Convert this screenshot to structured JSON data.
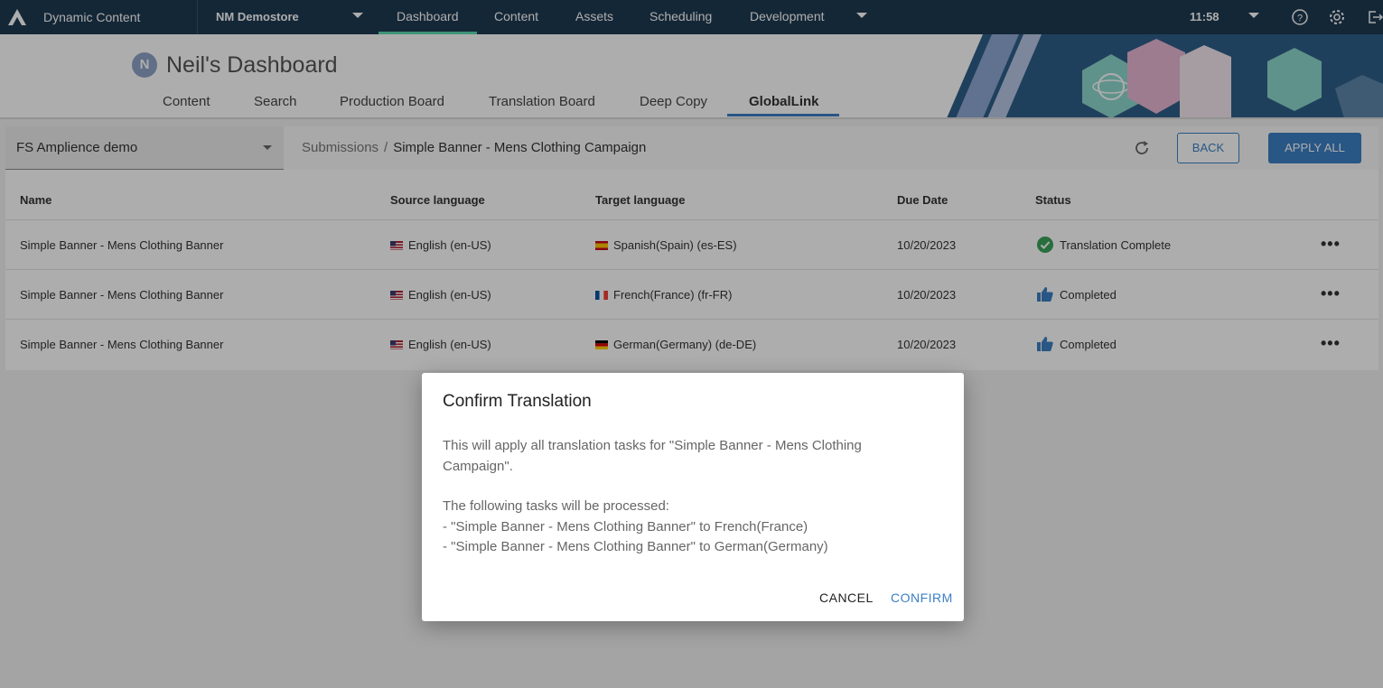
{
  "topbar": {
    "app_title": "Dynamic Content",
    "store": "NM Demostore",
    "nav": [
      "Dashboard",
      "Content",
      "Assets",
      "Scheduling",
      "Development"
    ],
    "active_nav": "Dashboard",
    "time": "11:58"
  },
  "header": {
    "avatar_initial": "N",
    "title": "Neil's Dashboard",
    "tabs": [
      "Content",
      "Search",
      "Production Board",
      "Translation Board",
      "Deep Copy",
      "GlobalLink"
    ],
    "active_tab": "GlobalLink"
  },
  "toolbar": {
    "project": "FS Amplience demo",
    "breadcrumb_root": "Submissions",
    "breadcrumb_sep": "/",
    "breadcrumb_current": "Simple Banner - Mens Clothing Campaign",
    "back_label": "BACK",
    "apply_all_label": "APPLY ALL"
  },
  "table": {
    "headers": [
      "Name",
      "Source language",
      "Target language",
      "Due Date",
      "Status"
    ],
    "rows": [
      {
        "name": "Simple Banner - Mens Clothing Banner",
        "source": "English (en-US)",
        "target": "Spanish(Spain) (es-ES)",
        "due": "10/20/2023",
        "status": "Translation Complete",
        "status_icon": "check-circle-icon"
      },
      {
        "name": "Simple Banner - Mens Clothing Banner",
        "source": "English (en-US)",
        "target": "French(France) (fr-FR)",
        "due": "10/20/2023",
        "status": "Completed",
        "status_icon": "thumbs-up-icon"
      },
      {
        "name": "Simple Banner - Mens Clothing Banner",
        "source": "English (en-US)",
        "target": "German(Germany) (de-DE)",
        "due": "10/20/2023",
        "status": "Completed",
        "status_icon": "thumbs-up-icon"
      }
    ],
    "more_label": "•••"
  },
  "dialog": {
    "title": "Confirm Translation",
    "paragraph1_line1": "This will apply all translation tasks for \"Simple Banner - Mens Clothing",
    "paragraph1_line2": "Campaign\".",
    "paragraph2_intro": "The following tasks will be processed:",
    "tasks": [
      "- \"Simple Banner - Mens Clothing Banner\" to French(France)",
      "- \"Simple Banner - Mens Clothing Banner\" to German(Germany)"
    ],
    "cancel_label": "CANCEL",
    "confirm_label": "CONFIRM"
  },
  "colors": {
    "topbar": "#1e3a52",
    "accent": "#3b7fc4",
    "active_nav_underline": "#5cdbb3",
    "success": "#3aa35a"
  }
}
